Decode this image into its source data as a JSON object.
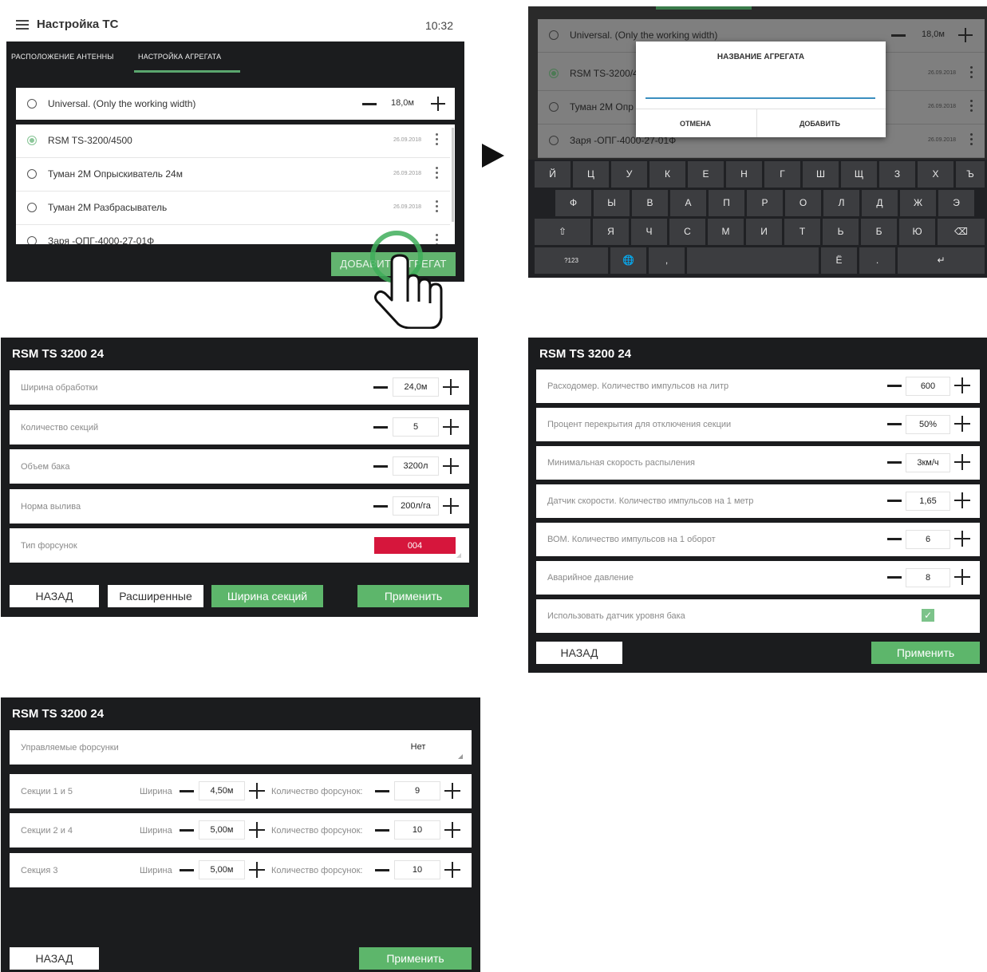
{
  "vehicle_settings": {
    "title": "Настройка ТС",
    "time": "10:32",
    "tabs": [
      "РАСПОЛОЖЕНИЕ АНТЕННЫ",
      "НАСТРОЙКА АГРЕГАТА"
    ],
    "universal": {
      "label": "Universal. (Only the working width)",
      "value": "18,0м"
    },
    "units": [
      {
        "label": "RSM TS-3200/4500",
        "date": "26.09.2018",
        "selected": true
      },
      {
        "label": "Туман 2М Опрыскиватель 24м",
        "date": "26.09.2018",
        "selected": false
      },
      {
        "label": "Туман 2М Разбрасыватель",
        "date": "26.09.2018",
        "selected": false
      },
      {
        "label": "Заря -ОПГ-4000-27-01Ф",
        "date": "",
        "selected": false
      }
    ],
    "add_button": "ДОБАВИТЬ АГРЕГАТ"
  },
  "name_dialog": {
    "universal": {
      "label": "Universal. (Only the working width)",
      "value": "18,0м"
    },
    "units": [
      {
        "label": "RSM TS-3200/4",
        "date": "26.09.2018",
        "selected": true
      },
      {
        "label": "Туман 2М Опр",
        "date": "26.09.2018",
        "selected": false
      },
      {
        "label": "Заря -ОПГ-4000-27-01Ф",
        "date": "26.09.2018",
        "selected": false
      }
    ],
    "title": "НАЗВАНИЕ АГРЕГАТА",
    "cancel": "ОТМЕНА",
    "add": "ДОБАВИТЬ",
    "keyboard": {
      "row1": [
        "Й",
        "Ц",
        "У",
        "К",
        "Е",
        "Н",
        "Г",
        "Ш",
        "Щ",
        "З",
        "Х",
        "Ъ"
      ],
      "row2": [
        "Ф",
        "Ы",
        "В",
        "А",
        "П",
        "Р",
        "О",
        "Л",
        "Д",
        "Ж",
        "Э"
      ],
      "row3": [
        "⇧",
        "Я",
        "Ч",
        "С",
        "М",
        "И",
        "Т",
        "Ь",
        "Б",
        "Ю",
        "⌫"
      ],
      "row4": [
        "?123",
        "🌐",
        ",",
        "",
        "Ё",
        ".",
        "↵"
      ]
    }
  },
  "main_params": {
    "title": "RSM TS 3200 24",
    "rows": [
      {
        "label": "Ширина обработки",
        "value": "24,0м"
      },
      {
        "label": "Количество секций",
        "value": "5"
      },
      {
        "label": "Объем бака",
        "value": "3200л"
      },
      {
        "label": "Норма вылива",
        "value": "200л/га"
      }
    ],
    "nozzle_type": {
      "label": "Тип форсунок",
      "value": "004",
      "color": "#d6163c"
    },
    "buttons": {
      "back": "НАЗАД",
      "advanced": "Расширенные",
      "section_width": "Ширина секций",
      "apply": "Применить"
    }
  },
  "advanced_params": {
    "title": "RSM TS 3200 24",
    "rows": [
      {
        "label": "Расходомер. Количество импульсов на литр",
        "value": "600"
      },
      {
        "label": "Процент перекрытия для отключения секции",
        "value": "50%"
      },
      {
        "label": "Минимальная скорость распыления",
        "value": "3км/ч"
      },
      {
        "label": "Датчик скорости. Количество импульсов на 1 метр",
        "value": "1,65"
      },
      {
        "label": "ВОМ. Количество импульсов на 1 оборот",
        "value": "6"
      },
      {
        "label": "Аварийное давление",
        "value": "8"
      }
    ],
    "tank_sensor": {
      "label": "Использовать датчик уровня бака",
      "checked": true
    },
    "buttons": {
      "back": "НАЗАД",
      "apply": "Применить"
    }
  },
  "section_widths": {
    "title": "RSM TS 3200 24",
    "controlled_nozzles": {
      "label": "Управляемые форсунки",
      "value": "Нет"
    },
    "width_label": "Ширина",
    "count_label": "Количество форсунок:",
    "sections": [
      {
        "label": "Секции 1 и 5",
        "width": "4,50м",
        "count": "9"
      },
      {
        "label": "Секции 2 и 4",
        "width": "5,00м",
        "count": "10"
      },
      {
        "label": "Секция 3",
        "width": "5,00м",
        "count": "10"
      }
    ],
    "buttons": {
      "back": "НАЗАД",
      "apply": "Применить"
    }
  },
  "colors": {
    "accent_green": "#5db66b",
    "panel_dark": "#1b1c1e",
    "nozzle_red": "#d6163c"
  }
}
